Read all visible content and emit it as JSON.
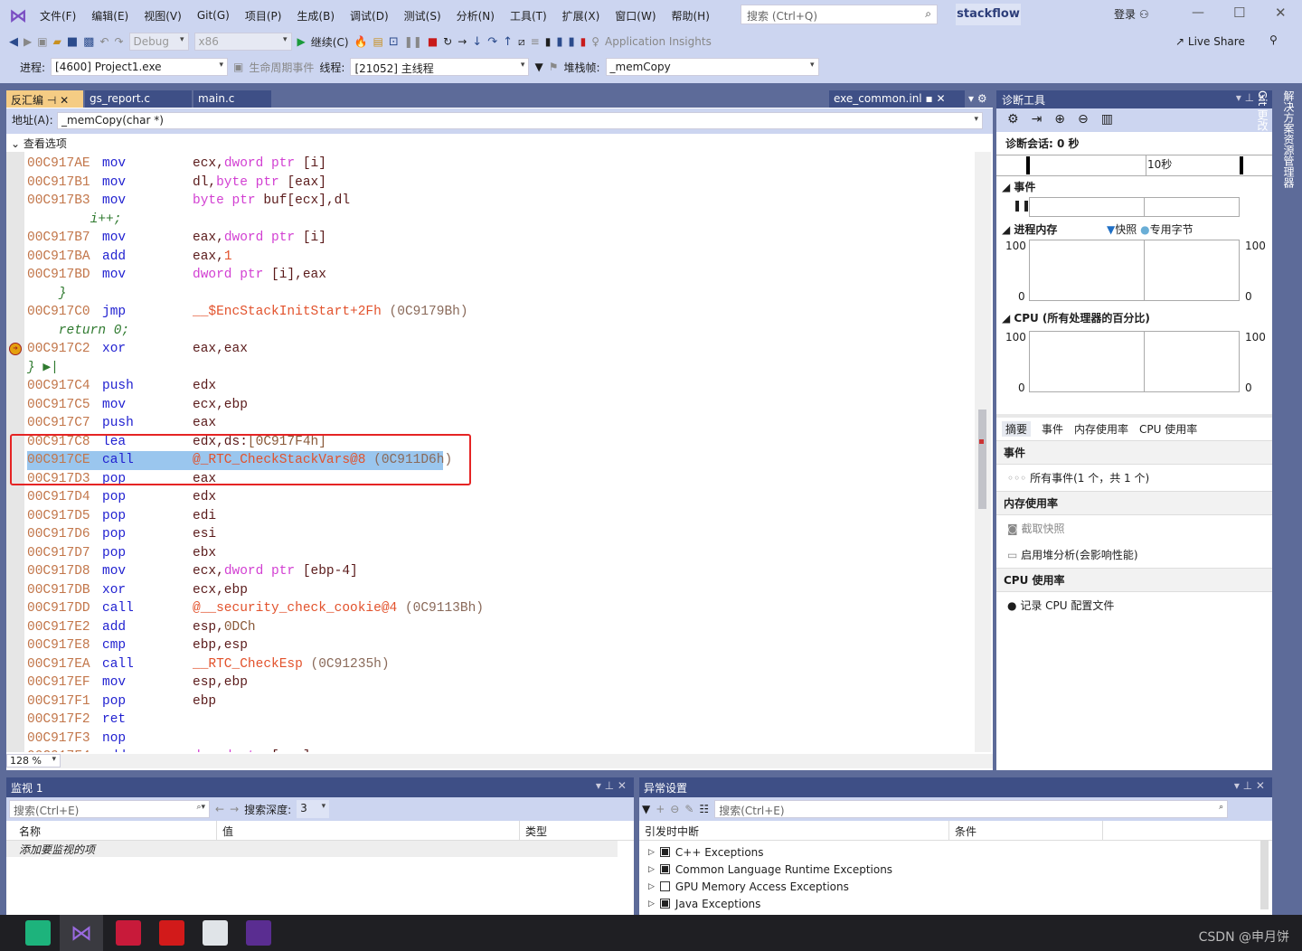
{
  "menu": [
    "文件(F)",
    "编辑(E)",
    "视图(V)",
    "Git(G)",
    "项目(P)",
    "生成(B)",
    "调试(D)",
    "测试(S)",
    "分析(N)",
    "工具(T)",
    "扩展(X)",
    "窗口(W)",
    "帮助(H)"
  ],
  "search_placeholder": "搜索 (Ctrl+Q)",
  "project_name": "stackflow",
  "login": "登录",
  "toolbar": {
    "config": "Debug",
    "platform": "x86",
    "continue": "继续(C)",
    "app_insights": "Application Insights",
    "live_share": "Live Share"
  },
  "debugbar": {
    "process_label": "进程:",
    "process": "[4600] Project1.exe",
    "lifecycle": "生命周期事件",
    "thread_label": "线程:",
    "thread": "[21052] 主线程",
    "stackframe_label": "堆栈帧:",
    "stackframe": "_memCopy"
  },
  "tabs": [
    "反汇编",
    "gs_report.c",
    "main.c"
  ],
  "right_tab": "exe_common.inl",
  "address_label": "地址(A):",
  "address_value": "_memCopy(char *)",
  "view_options": "查看选项",
  "zoom": "128 %",
  "code": [
    {
      "a": "00C917AE",
      "m": "mov",
      "o": [
        [
          "ecx,",
          "reg"
        ],
        [
          "dword ptr ",
          "kw"
        ],
        [
          "[i]",
          "reg"
        ]
      ]
    },
    {
      "a": "00C917B1",
      "m": "mov",
      "o": [
        [
          "dl,",
          "reg"
        ],
        [
          "byte ptr ",
          "kw"
        ],
        [
          "[eax]",
          "reg"
        ]
      ]
    },
    {
      "a": "00C917B3",
      "m": "mov",
      "o": [
        [
          "byte ptr ",
          "kw"
        ],
        [
          "buf[ecx],dl",
          "reg"
        ]
      ]
    },
    {
      "s": "        i++;"
    },
    {
      "a": "00C917B7",
      "m": "mov",
      "o": [
        [
          "eax,",
          "reg"
        ],
        [
          "dword ptr ",
          "kw"
        ],
        [
          "[i]",
          "reg"
        ]
      ]
    },
    {
      "a": "00C917BA",
      "m": "add",
      "o": [
        [
          "eax,",
          "reg"
        ],
        [
          "1",
          "sym"
        ]
      ]
    },
    {
      "a": "00C917BD",
      "m": "mov",
      "o": [
        [
          "dword ptr ",
          "kw"
        ],
        [
          "[i],eax",
          "reg"
        ]
      ]
    },
    {
      "s": "    }"
    },
    {
      "a": "00C917C0",
      "m": "jmp",
      "o": [
        [
          "__$EncStackInitStart+2Fh",
          "sym"
        ],
        [
          " (0C9179Bh)",
          "addr"
        ]
      ]
    },
    {
      "s": "    return 0;"
    },
    {
      "a": "00C917C2",
      "m": "xor",
      "o": [
        [
          "eax,eax",
          "reg"
        ]
      ],
      "bp": true
    },
    {
      "s": "} ▶|"
    },
    {
      "a": "00C917C4",
      "m": "push",
      "o": [
        [
          "edx",
          "reg"
        ]
      ]
    },
    {
      "a": "00C917C5",
      "m": "mov",
      "o": [
        [
          "ecx,ebp",
          "reg"
        ]
      ]
    },
    {
      "a": "00C917C7",
      "m": "push",
      "o": [
        [
          "eax",
          "reg"
        ]
      ]
    },
    {
      "a": "00C917C8",
      "m": "lea",
      "o": [
        [
          "edx,ds:",
          "reg"
        ],
        [
          "[0C917F4h]",
          "num"
        ]
      ]
    },
    {
      "a": "00C917CE",
      "m": "call",
      "o": [
        [
          "@_RTC_CheckStackVars@8",
          "sym"
        ],
        [
          " (0C911D6h)",
          "addr"
        ]
      ],
      "sel": true
    },
    {
      "a": "00C917D3",
      "m": "pop",
      "o": [
        [
          "eax",
          "reg"
        ]
      ]
    },
    {
      "a": "00C917D4",
      "m": "pop",
      "o": [
        [
          "edx",
          "reg"
        ]
      ]
    },
    {
      "a": "00C917D5",
      "m": "pop",
      "o": [
        [
          "edi",
          "reg"
        ]
      ]
    },
    {
      "a": "00C917D6",
      "m": "pop",
      "o": [
        [
          "esi",
          "reg"
        ]
      ]
    },
    {
      "a": "00C917D7",
      "m": "pop",
      "o": [
        [
          "ebx",
          "reg"
        ]
      ]
    },
    {
      "a": "00C917D8",
      "m": "mov",
      "o": [
        [
          "ecx,",
          "reg"
        ],
        [
          "dword ptr ",
          "kw"
        ],
        [
          "[ebp-4]",
          "reg"
        ]
      ]
    },
    {
      "a": "00C917DB",
      "m": "xor",
      "o": [
        [
          "ecx,ebp",
          "reg"
        ]
      ]
    },
    {
      "a": "00C917DD",
      "m": "call",
      "o": [
        [
          "@__security_check_cookie@4",
          "sym"
        ],
        [
          " (0C9113Bh)",
          "addr"
        ]
      ]
    },
    {
      "a": "00C917E2",
      "m": "add",
      "o": [
        [
          "esp,",
          "reg"
        ],
        [
          "0DCh",
          "num"
        ]
      ]
    },
    {
      "a": "00C917E8",
      "m": "cmp",
      "o": [
        [
          "ebp,esp",
          "reg"
        ]
      ]
    },
    {
      "a": "00C917EA",
      "m": "call",
      "o": [
        [
          "__RTC_CheckEsp",
          "sym"
        ],
        [
          " (0C91235h)",
          "addr"
        ]
      ]
    },
    {
      "a": "00C917EF",
      "m": "mov",
      "o": [
        [
          "esp,ebp",
          "reg"
        ]
      ]
    },
    {
      "a": "00C917F1",
      "m": "pop",
      "o": [
        [
          "ebp",
          "reg"
        ]
      ]
    },
    {
      "a": "00C917F2",
      "m": "ret",
      "o": []
    },
    {
      "a": "00C917F3",
      "m": "nop",
      "o": []
    },
    {
      "a": "00C917F4",
      "m": "add",
      "o": [
        [
          "dword ptr ",
          "kw"
        ],
        [
          "[eax],eax",
          "reg"
        ]
      ]
    }
  ],
  "diag": {
    "title": "诊断工具",
    "session": "诊断会话: 0 秒",
    "timeline_label": "10秒",
    "events": "事件",
    "process_memory": "进程内存",
    "snapshot": "快照",
    "private_bytes": "专用字节",
    "y_max": "100",
    "y_min": "0",
    "cpu": "CPU (所有处理器的百分比)",
    "tabs": [
      "摘要",
      "事件",
      "内存使用率",
      "CPU 使用率"
    ],
    "sec_events": "事件",
    "all_events": "所有事件(1 个，共 1 个)",
    "sec_memory": "内存使用率",
    "take_snapshot": "截取快照",
    "heap_profiling": "启用堆分析(会影响性能)",
    "sec_cpu": "CPU 使用率",
    "record_cpu": "记录 CPU 配置文件"
  },
  "side_tabs": [
    "解决方案资源管理器",
    "Git 更改"
  ],
  "watch": {
    "title": "监视 1",
    "search": "搜索(Ctrl+E)",
    "depth_label": "搜索深度:",
    "depth": "3",
    "cols": [
      "名称",
      "值",
      "类型"
    ],
    "add_item": "添加要监视的项"
  },
  "exceptions": {
    "title": "异常设置",
    "search": "搜索(Ctrl+E)",
    "cols": [
      "引发时中断",
      "条件"
    ],
    "rows": [
      {
        "label": "C++ Exceptions",
        "checked": true
      },
      {
        "label": "Common Language Runtime Exceptions",
        "checked": true
      },
      {
        "label": "GPU Memory Access Exceptions",
        "checked": false
      },
      {
        "label": "Java Exceptions",
        "checked": true
      }
    ]
  },
  "watermark": "CSDN @申月饼"
}
